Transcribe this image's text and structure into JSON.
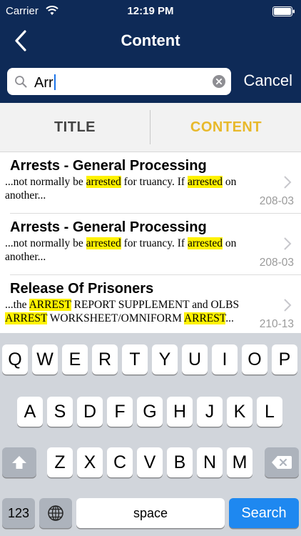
{
  "status_bar": {
    "carrier": "Carrier",
    "time": "12:19 PM"
  },
  "nav": {
    "title": "Content"
  },
  "search": {
    "value": "Arr",
    "cancel_label": "Cancel"
  },
  "tabs": [
    {
      "label": "TITLE",
      "active": false
    },
    {
      "label": "CONTENT",
      "active": true
    }
  ],
  "results": [
    {
      "title": "Arrests - General Processing",
      "snippet_parts": [
        {
          "text": "...not normally be ",
          "hl": false
        },
        {
          "text": "arrested",
          "hl": true
        },
        {
          "text": " for truancy. If ",
          "hl": false
        },
        {
          "text": "arrested",
          "hl": true
        },
        {
          "text": " on another...",
          "hl": false
        }
      ],
      "code": "208-03"
    },
    {
      "title": "Arrests - General Processing",
      "snippet_parts": [
        {
          "text": "...not normally be ",
          "hl": false
        },
        {
          "text": "arrested",
          "hl": true
        },
        {
          "text": " for truancy. If ",
          "hl": false
        },
        {
          "text": "arrested",
          "hl": true
        },
        {
          "text": " on another...",
          "hl": false
        }
      ],
      "code": "208-03"
    },
    {
      "title": "Release Of Prisoners",
      "snippet_parts": [
        {
          "text": "...the ",
          "hl": false
        },
        {
          "text": "ARREST",
          "hl": true
        },
        {
          "text": " REPORT SUPPLEMENT and OLBS ",
          "hl": false
        },
        {
          "text": "ARREST",
          "hl": true
        },
        {
          "text": " WORKSHEET/OMNIFORM ",
          "hl": false
        },
        {
          "text": "ARREST",
          "hl": true
        },
        {
          "text": "...",
          "hl": false
        }
      ],
      "code": "210-13"
    }
  ],
  "keyboard": {
    "row1": [
      "Q",
      "W",
      "E",
      "R",
      "T",
      "Y",
      "U",
      "I",
      "O",
      "P"
    ],
    "row2": [
      "A",
      "S",
      "D",
      "F",
      "G",
      "H",
      "J",
      "K",
      "L"
    ],
    "row3": [
      "Z",
      "X",
      "C",
      "V",
      "B",
      "N",
      "M"
    ],
    "numbers_label": "123",
    "space_label": "space",
    "search_label": "Search"
  },
  "colors": {
    "header": "#0e2a57",
    "tab_active": "#e8b92b",
    "highlight": "#fff200",
    "search_key": "#1e88f0"
  },
  "icons": [
    "wifi-icon",
    "battery-icon",
    "back-chevron-icon",
    "search-icon",
    "clear-icon",
    "chevron-right-icon",
    "shift-icon",
    "globe-icon",
    "delete-icon"
  ]
}
